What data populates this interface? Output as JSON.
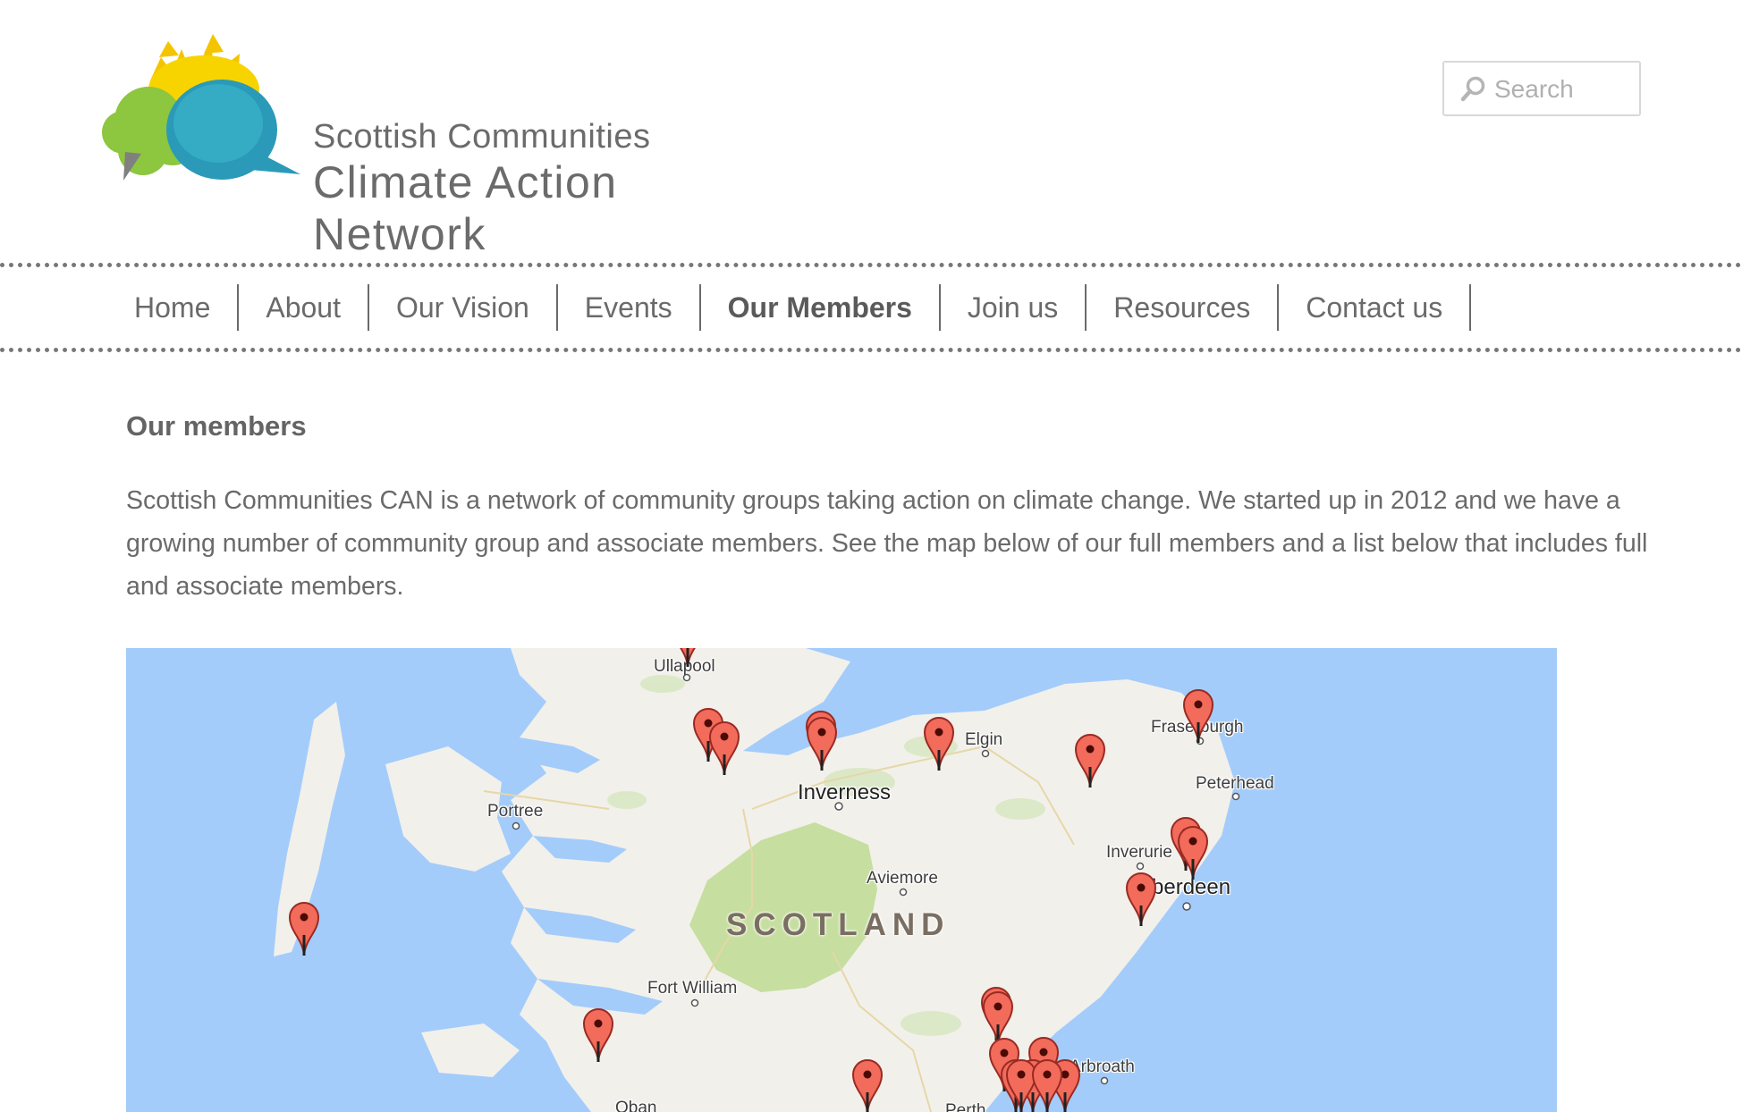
{
  "logo": {
    "line1": "Scottish Communities",
    "line2": "Climate Action Network"
  },
  "search": {
    "placeholder": "Search",
    "value": ""
  },
  "nav": {
    "items": [
      {
        "label": "Home",
        "active": false
      },
      {
        "label": "About",
        "active": false
      },
      {
        "label": "Our Vision",
        "active": false
      },
      {
        "label": "Events",
        "active": false
      },
      {
        "label": "Our Members",
        "active": true
      },
      {
        "label": "Join us",
        "active": false
      },
      {
        "label": "Resources",
        "active": false
      },
      {
        "label": "Contact us",
        "active": false
      }
    ]
  },
  "main": {
    "title": "Our members",
    "intro": "Scottish Communities CAN is a network of community groups taking action on climate change. We started up in 2012 and we have a growing number of community group and associate members. See the map below of our full members and a list below that includes full and associate members."
  },
  "map": {
    "country_label": "SCOTLAND",
    "places": [
      "Ullapool",
      "Elgin",
      "Fraserburgh",
      "Peterhead",
      "Inverness",
      "Portree",
      "Inverurie",
      "Aberdeen",
      "Aviemore",
      "Fort William",
      "Arbroath",
      "Oban",
      "Perth"
    ],
    "marker_count": 23
  },
  "colors": {
    "sea": "#a3ccfb",
    "land": "#f2f0eb",
    "park": "#c6dea0",
    "marker": "#f26b5b",
    "text": "#6a6a6a"
  }
}
